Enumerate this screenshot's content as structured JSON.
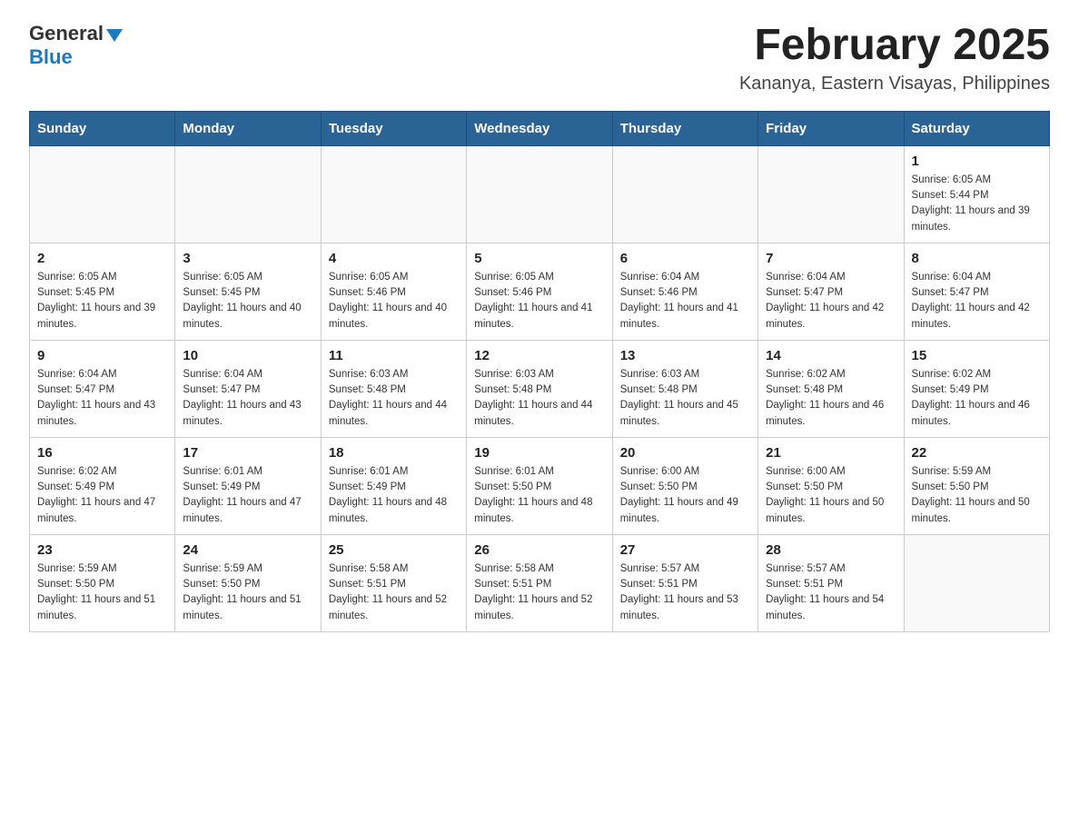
{
  "header": {
    "logo_general": "General",
    "logo_blue": "Blue",
    "title": "February 2025",
    "subtitle": "Kananya, Eastern Visayas, Philippines"
  },
  "calendar": {
    "days_of_week": [
      "Sunday",
      "Monday",
      "Tuesday",
      "Wednesday",
      "Thursday",
      "Friday",
      "Saturday"
    ],
    "weeks": [
      [
        {
          "day": "",
          "info": ""
        },
        {
          "day": "",
          "info": ""
        },
        {
          "day": "",
          "info": ""
        },
        {
          "day": "",
          "info": ""
        },
        {
          "day": "",
          "info": ""
        },
        {
          "day": "",
          "info": ""
        },
        {
          "day": "1",
          "info": "Sunrise: 6:05 AM\nSunset: 5:44 PM\nDaylight: 11 hours and 39 minutes."
        }
      ],
      [
        {
          "day": "2",
          "info": "Sunrise: 6:05 AM\nSunset: 5:45 PM\nDaylight: 11 hours and 39 minutes."
        },
        {
          "day": "3",
          "info": "Sunrise: 6:05 AM\nSunset: 5:45 PM\nDaylight: 11 hours and 40 minutes."
        },
        {
          "day": "4",
          "info": "Sunrise: 6:05 AM\nSunset: 5:46 PM\nDaylight: 11 hours and 40 minutes."
        },
        {
          "day": "5",
          "info": "Sunrise: 6:05 AM\nSunset: 5:46 PM\nDaylight: 11 hours and 41 minutes."
        },
        {
          "day": "6",
          "info": "Sunrise: 6:04 AM\nSunset: 5:46 PM\nDaylight: 11 hours and 41 minutes."
        },
        {
          "day": "7",
          "info": "Sunrise: 6:04 AM\nSunset: 5:47 PM\nDaylight: 11 hours and 42 minutes."
        },
        {
          "day": "8",
          "info": "Sunrise: 6:04 AM\nSunset: 5:47 PM\nDaylight: 11 hours and 42 minutes."
        }
      ],
      [
        {
          "day": "9",
          "info": "Sunrise: 6:04 AM\nSunset: 5:47 PM\nDaylight: 11 hours and 43 minutes."
        },
        {
          "day": "10",
          "info": "Sunrise: 6:04 AM\nSunset: 5:47 PM\nDaylight: 11 hours and 43 minutes."
        },
        {
          "day": "11",
          "info": "Sunrise: 6:03 AM\nSunset: 5:48 PM\nDaylight: 11 hours and 44 minutes."
        },
        {
          "day": "12",
          "info": "Sunrise: 6:03 AM\nSunset: 5:48 PM\nDaylight: 11 hours and 44 minutes."
        },
        {
          "day": "13",
          "info": "Sunrise: 6:03 AM\nSunset: 5:48 PM\nDaylight: 11 hours and 45 minutes."
        },
        {
          "day": "14",
          "info": "Sunrise: 6:02 AM\nSunset: 5:48 PM\nDaylight: 11 hours and 46 minutes."
        },
        {
          "day": "15",
          "info": "Sunrise: 6:02 AM\nSunset: 5:49 PM\nDaylight: 11 hours and 46 minutes."
        }
      ],
      [
        {
          "day": "16",
          "info": "Sunrise: 6:02 AM\nSunset: 5:49 PM\nDaylight: 11 hours and 47 minutes."
        },
        {
          "day": "17",
          "info": "Sunrise: 6:01 AM\nSunset: 5:49 PM\nDaylight: 11 hours and 47 minutes."
        },
        {
          "day": "18",
          "info": "Sunrise: 6:01 AM\nSunset: 5:49 PM\nDaylight: 11 hours and 48 minutes."
        },
        {
          "day": "19",
          "info": "Sunrise: 6:01 AM\nSunset: 5:50 PM\nDaylight: 11 hours and 48 minutes."
        },
        {
          "day": "20",
          "info": "Sunrise: 6:00 AM\nSunset: 5:50 PM\nDaylight: 11 hours and 49 minutes."
        },
        {
          "day": "21",
          "info": "Sunrise: 6:00 AM\nSunset: 5:50 PM\nDaylight: 11 hours and 50 minutes."
        },
        {
          "day": "22",
          "info": "Sunrise: 5:59 AM\nSunset: 5:50 PM\nDaylight: 11 hours and 50 minutes."
        }
      ],
      [
        {
          "day": "23",
          "info": "Sunrise: 5:59 AM\nSunset: 5:50 PM\nDaylight: 11 hours and 51 minutes."
        },
        {
          "day": "24",
          "info": "Sunrise: 5:59 AM\nSunset: 5:50 PM\nDaylight: 11 hours and 51 minutes."
        },
        {
          "day": "25",
          "info": "Sunrise: 5:58 AM\nSunset: 5:51 PM\nDaylight: 11 hours and 52 minutes."
        },
        {
          "day": "26",
          "info": "Sunrise: 5:58 AM\nSunset: 5:51 PM\nDaylight: 11 hours and 52 minutes."
        },
        {
          "day": "27",
          "info": "Sunrise: 5:57 AM\nSunset: 5:51 PM\nDaylight: 11 hours and 53 minutes."
        },
        {
          "day": "28",
          "info": "Sunrise: 5:57 AM\nSunset: 5:51 PM\nDaylight: 11 hours and 54 minutes."
        },
        {
          "day": "",
          "info": ""
        }
      ]
    ]
  }
}
